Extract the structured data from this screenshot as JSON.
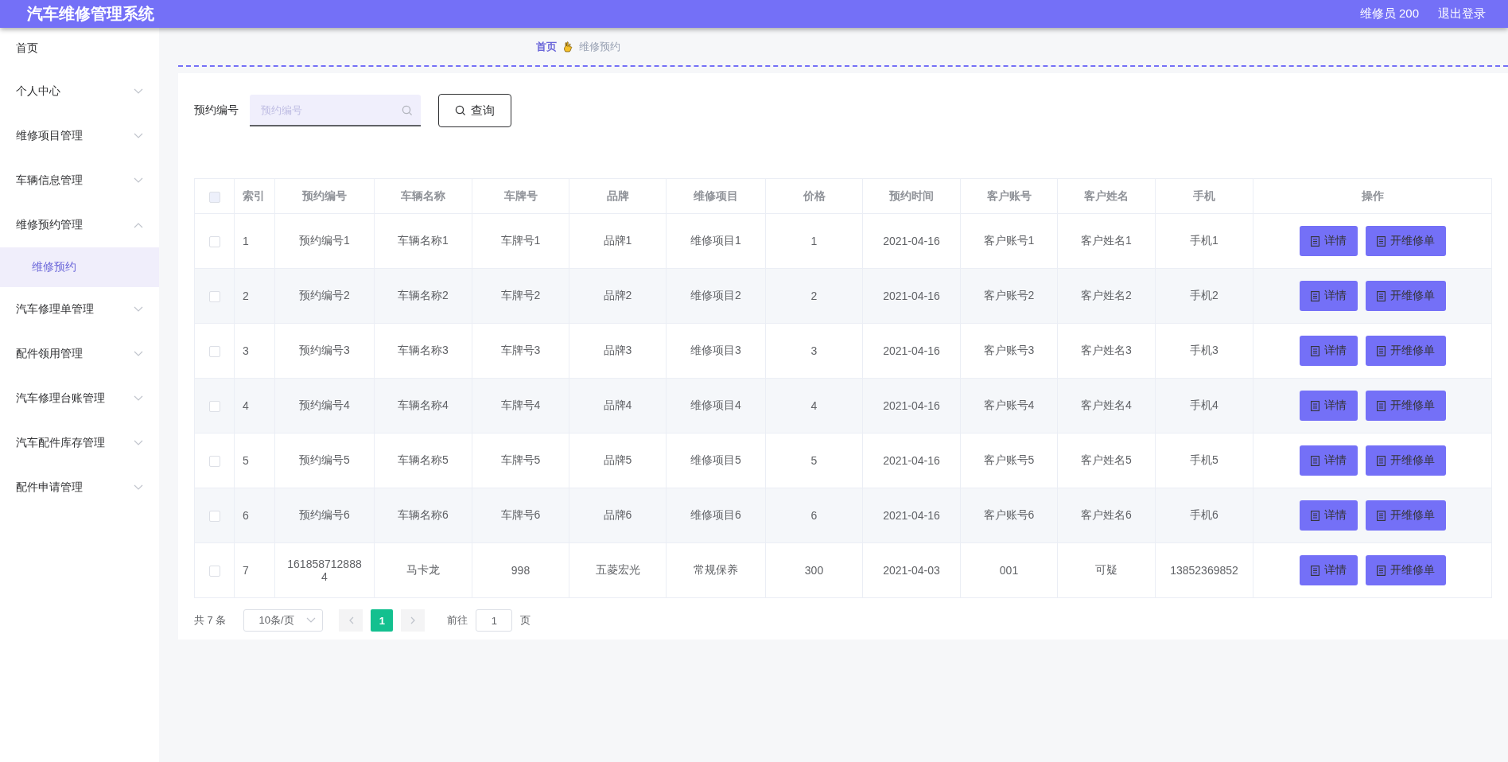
{
  "header": {
    "title": "汽车维修管理系统",
    "user": "维修员 200",
    "logout": "退出登录"
  },
  "sidebar": {
    "items": [
      {
        "label": "首页",
        "kind": "link"
      },
      {
        "label": "个人中心",
        "kind": "group",
        "expanded": false
      },
      {
        "label": "维修项目管理",
        "kind": "group",
        "expanded": false
      },
      {
        "label": "车辆信息管理",
        "kind": "group",
        "expanded": false
      },
      {
        "label": "维修预约管理",
        "kind": "group",
        "expanded": true,
        "children": [
          {
            "label": "维修预约",
            "selected": true
          }
        ]
      },
      {
        "label": "汽车修理单管理",
        "kind": "group",
        "expanded": false
      },
      {
        "label": "配件领用管理",
        "kind": "group",
        "expanded": false
      },
      {
        "label": "汽车修理台账管理",
        "kind": "group",
        "expanded": false
      },
      {
        "label": "汽车配件库存管理",
        "kind": "group",
        "expanded": false
      },
      {
        "label": "配件申请管理",
        "kind": "group",
        "expanded": false
      }
    ]
  },
  "breadcrumb": [
    "首页",
    "维修预约"
  ],
  "search": {
    "label": "预约编号",
    "placeholder": "预约编号",
    "button": "查询"
  },
  "table": {
    "all_checked": false,
    "columns": [
      "索引",
      "预约编号",
      "车辆名称",
      "车牌号",
      "品牌",
      "维修项目",
      "价格",
      "预约时间",
      "客户账号",
      "客户姓名",
      "手机",
      "操作"
    ],
    "rows": [
      {
        "checked": false,
        "cells": [
          "1",
          "预约编号1",
          "车辆名称1",
          "车牌号1",
          "品牌1",
          "维修项目1",
          "1",
          "2021-04-16",
          "客户账号1",
          "客户姓名1",
          "手机1"
        ],
        "actions": [
          "详情",
          "开维修单"
        ]
      },
      {
        "checked": false,
        "cells": [
          "2",
          "预约编号2",
          "车辆名称2",
          "车牌号2",
          "品牌2",
          "维修项目2",
          "2",
          "2021-04-16",
          "客户账号2",
          "客户姓名2",
          "手机2"
        ],
        "actions": [
          "详情",
          "开维修单"
        ]
      },
      {
        "checked": false,
        "cells": [
          "3",
          "预约编号3",
          "车辆名称3",
          "车牌号3",
          "品牌3",
          "维修项目3",
          "3",
          "2021-04-16",
          "客户账号3",
          "客户姓名3",
          "手机3"
        ],
        "actions": [
          "详情",
          "开维修单"
        ]
      },
      {
        "checked": false,
        "cells": [
          "4",
          "预约编号4",
          "车辆名称4",
          "车牌号4",
          "品牌4",
          "维修项目4",
          "4",
          "2021-04-16",
          "客户账号4",
          "客户姓名4",
          "手机4"
        ],
        "actions": [
          "详情",
          "开维修单"
        ]
      },
      {
        "checked": false,
        "cells": [
          "5",
          "预约编号5",
          "车辆名称5",
          "车牌号5",
          "品牌5",
          "维修项目5",
          "5",
          "2021-04-16",
          "客户账号5",
          "客户姓名5",
          "手机5"
        ],
        "actions": [
          "详情",
          "开维修单"
        ]
      },
      {
        "checked": false,
        "cells": [
          "6",
          "预约编号6",
          "车辆名称6",
          "车牌号6",
          "品牌6",
          "维修项目6",
          "6",
          "2021-04-16",
          "客户账号6",
          "客户姓名6",
          "手机6"
        ],
        "actions": [
          "详情",
          "开维修单"
        ]
      },
      {
        "checked": false,
        "cells": [
          "7",
          "1618587128884",
          "马卡龙",
          "998",
          "五菱宏光",
          "常规保养",
          "300",
          "2021-04-03",
          "001",
          "可疑",
          "13852369852"
        ],
        "actions": [
          "详情",
          "开维修单"
        ]
      }
    ]
  },
  "pagination": {
    "total": "共 7 条",
    "page_size": "10条/页",
    "pages": [
      {
        "label": "1",
        "selected": true
      }
    ],
    "goto_label": "前往",
    "goto_value": "1",
    "goto_suffix": "页"
  }
}
